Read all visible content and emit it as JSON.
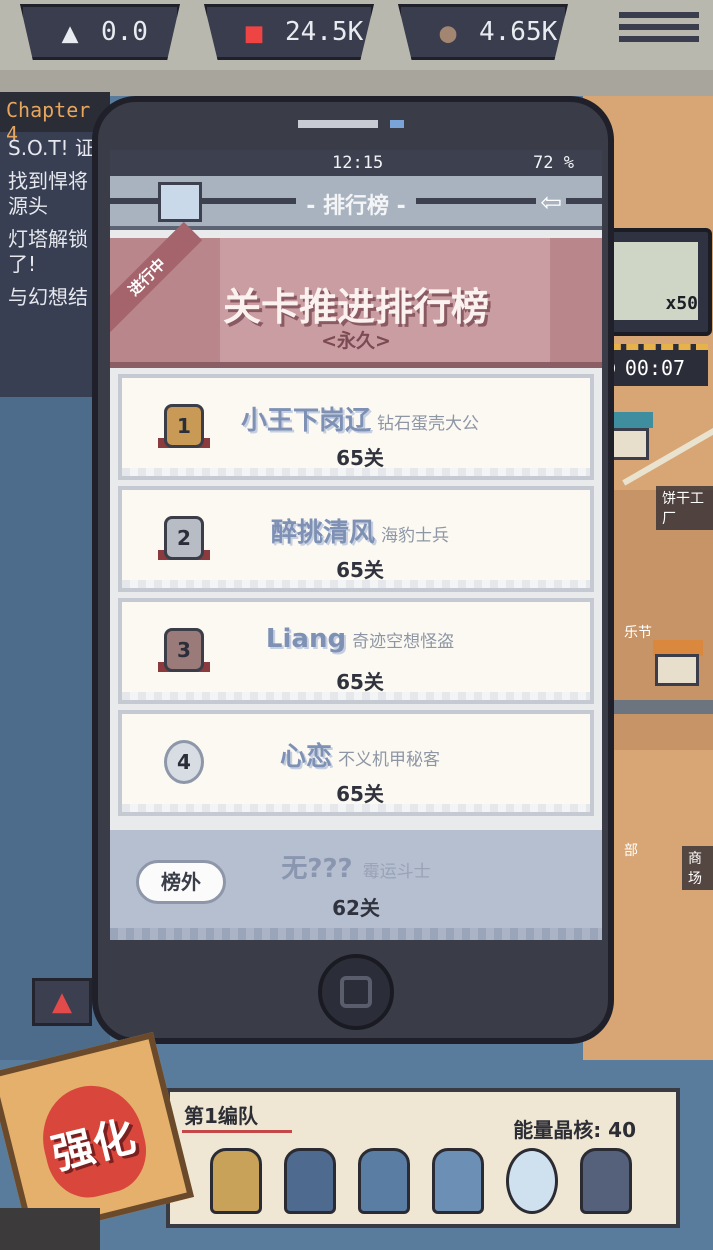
{
  "resources": [
    {
      "icon": "sail-icon",
      "value": "0.0"
    },
    {
      "icon": "parts-icon",
      "value": "24.5K"
    },
    {
      "icon": "ore-icon",
      "value": "4.65K"
    }
  ],
  "quest": {
    "chapter": "Chapter 4",
    "lines": [
      "S.O.T! 证",
      "找到悍将源头",
      "灯塔解锁了!",
      "与幻想结"
    ]
  },
  "reward": {
    "count": "x50",
    "timer": "00:07"
  },
  "map_labels": [
    "饼干工厂",
    "乐节",
    "部",
    "商场"
  ],
  "phone": {
    "status_time": "12:15",
    "battery": "72 %",
    "title": "- 排行榜 -",
    "back_icon": "back-arrow-icon",
    "banner": {
      "ribbon": "进行中",
      "title": "关卡推进排行榜",
      "subtitle": "<永久>"
    },
    "rows": [
      {
        "rank": "1",
        "name": "小王下岗辽",
        "title": "钻石蛋壳大公",
        "score": "65关",
        "color": "#c89a55"
      },
      {
        "rank": "2",
        "name": "醉挑清风",
        "title": "海豹士兵",
        "score": "65关",
        "color": "#b8bcc4"
      },
      {
        "rank": "3",
        "name": "Liang",
        "title": "奇迹空想怪盗",
        "score": "65关",
        "color": "#9b7a7a"
      },
      {
        "rank": "4",
        "name": "心恋",
        "title": "不义机甲秘客",
        "score": "65关",
        "color": "#d8dde3"
      }
    ],
    "self": {
      "tag": "榜外",
      "name": "无???",
      "title": "霉运斗士",
      "score": "62关"
    }
  },
  "squad": {
    "name": "第1编队",
    "energy": "能量晶核: 40"
  },
  "enhance_label": "强化"
}
